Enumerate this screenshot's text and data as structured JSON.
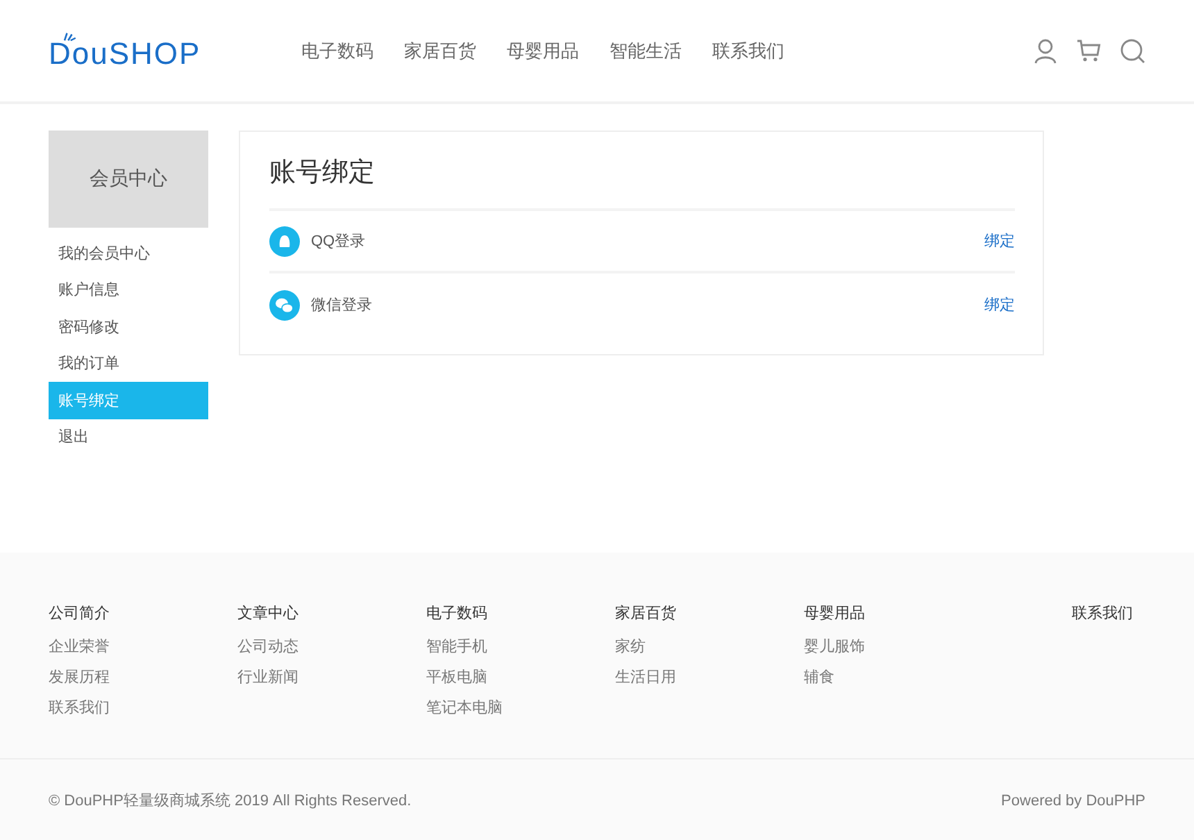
{
  "header": {
    "logo": "DouSHOP",
    "nav": [
      {
        "label": "电子数码"
      },
      {
        "label": "家居百货"
      },
      {
        "label": "母婴用品"
      },
      {
        "label": "智能生活"
      },
      {
        "label": "联系我们"
      }
    ]
  },
  "sidebar": {
    "title": "会员中心",
    "items": [
      {
        "label": "我的会员中心",
        "selected": false
      },
      {
        "label": "账户信息",
        "selected": false
      },
      {
        "label": "密码修改",
        "selected": false
      },
      {
        "label": "我的订单",
        "selected": false
      },
      {
        "label": "账号绑定",
        "selected": true
      },
      {
        "label": "退出",
        "selected": false
      }
    ]
  },
  "main": {
    "title": "账号绑定",
    "bindings": [
      {
        "kind": "qq",
        "label": "QQ登录",
        "action": "绑定"
      },
      {
        "kind": "wechat",
        "label": "微信登录",
        "action": "绑定"
      }
    ]
  },
  "footer": {
    "columns": [
      {
        "title": "公司简介",
        "links": [
          "企业荣誉",
          "发展历程",
          "联系我们"
        ]
      },
      {
        "title": "文章中心",
        "links": [
          "公司动态",
          "行业新闻"
        ]
      },
      {
        "title": "电子数码",
        "links": [
          "智能手机",
          "平板电脑",
          "笔记本电脑"
        ]
      },
      {
        "title": "家居百货",
        "links": [
          "家纺",
          "生活日用"
        ]
      },
      {
        "title": "母婴用品",
        "links": [
          "婴儿服饰",
          "辅食"
        ]
      }
    ],
    "contact": "联系我们",
    "copyright": "© DouPHP轻量级商城系统 2019 All Rights Reserved.",
    "powered": "Powered by DouPHP"
  }
}
